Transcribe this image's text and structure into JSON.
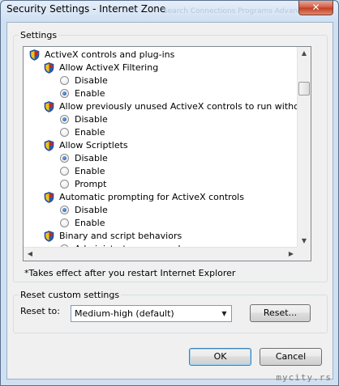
{
  "window": {
    "title": "Security Settings - Internet Zone",
    "background_title_ghost": "Search  Connections  Programs  Advanced",
    "close_glyph": "✕"
  },
  "settings": {
    "group_label": "Settings",
    "items": [
      {
        "kind": "category",
        "icon": "security-shield-icon",
        "label": "ActiveX controls and plug-ins"
      },
      {
        "kind": "setting",
        "icon": "security-shield-icon",
        "label": "Allow ActiveX Filtering"
      },
      {
        "kind": "option",
        "label": "Disable",
        "selected": false
      },
      {
        "kind": "option",
        "label": "Enable",
        "selected": true
      },
      {
        "kind": "setting",
        "icon": "security-shield-icon",
        "label": "Allow previously unused ActiveX controls to run without prom"
      },
      {
        "kind": "option",
        "label": "Disable",
        "selected": true
      },
      {
        "kind": "option",
        "label": "Enable",
        "selected": false
      },
      {
        "kind": "setting",
        "icon": "security-shield-icon",
        "label": "Allow Scriptlets"
      },
      {
        "kind": "option",
        "label": "Disable",
        "selected": true
      },
      {
        "kind": "option",
        "label": "Enable",
        "selected": false
      },
      {
        "kind": "option",
        "label": "Prompt",
        "selected": false
      },
      {
        "kind": "setting",
        "icon": "security-shield-icon",
        "label": "Automatic prompting for ActiveX controls"
      },
      {
        "kind": "option",
        "label": "Disable",
        "selected": true
      },
      {
        "kind": "option",
        "label": "Enable",
        "selected": false
      },
      {
        "kind": "setting",
        "icon": "security-shield-icon",
        "label": "Binary and script behaviors"
      },
      {
        "kind": "option",
        "label": "Administrator approved",
        "selected": false
      }
    ]
  },
  "note": "*Takes effect after you restart Internet Explorer",
  "reset": {
    "group_label": "Reset custom settings",
    "reset_to_label": "Reset to:",
    "level_value": "Medium-high (default)",
    "reset_button_label": "Reset..."
  },
  "footer": {
    "ok_label": "OK",
    "cancel_label": "Cancel"
  },
  "watermark": "mycity.rs",
  "colors": {
    "shield_blue": "#2a5db0",
    "shield_yellow": "#f3c316",
    "shield_red": "#c8281e",
    "radio_selected": "#1a4f9c",
    "default_button_border": "#3c7fb1"
  }
}
